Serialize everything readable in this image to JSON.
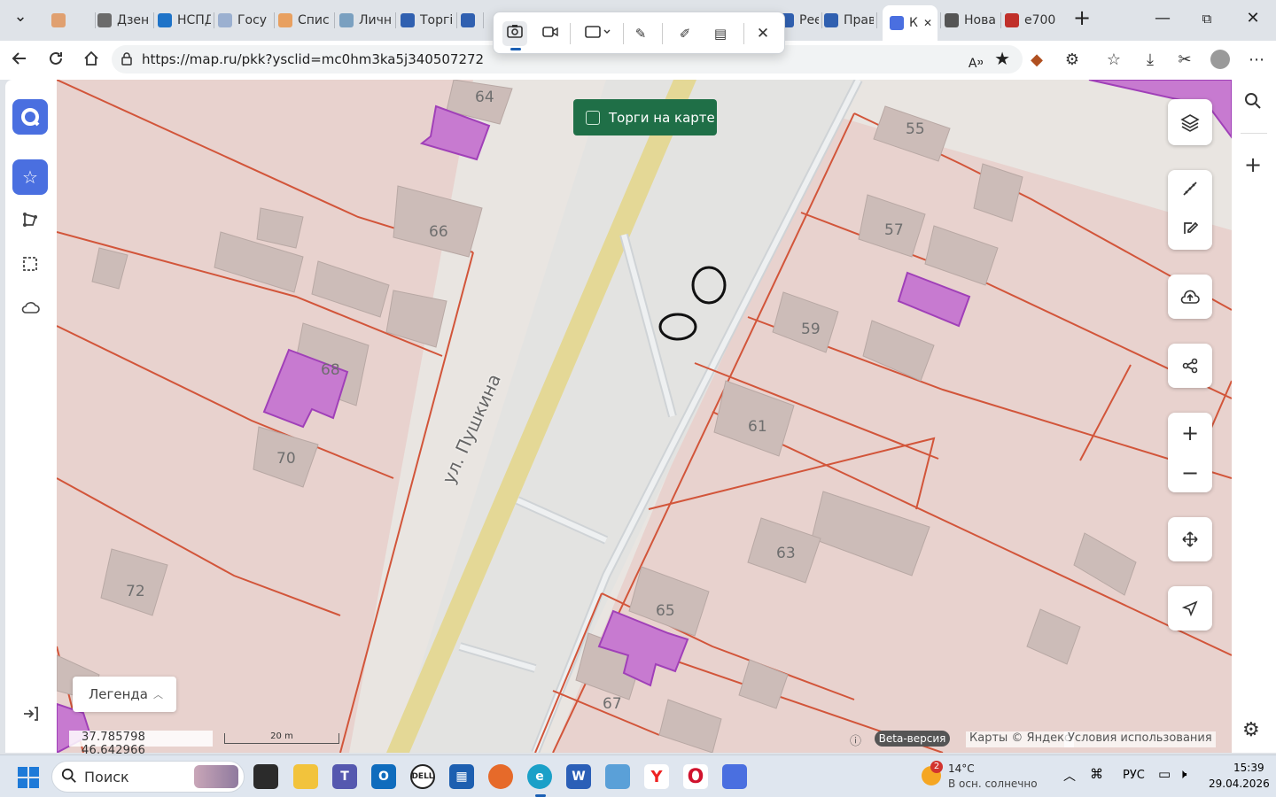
{
  "browser": {
    "tabs": [
      {
        "label": "",
        "icon": "mail-icon",
        "color": "#e0a070"
      },
      {
        "label": "Дзен",
        "icon": "dzen-icon",
        "color": "#6b6b6b"
      },
      {
        "label": "НСПД",
        "icon": "nspd-icon",
        "color": "#1e73c8"
      },
      {
        "label": "Госу",
        "icon": "gosuslugi-icon",
        "color": "#9bb0d0"
      },
      {
        "label": "Спис",
        "icon": "gmail-icon",
        "color": "#e8a060"
      },
      {
        "label": "Личн",
        "icon": "cabinet-icon",
        "color": "#7aa0c0"
      },
      {
        "label": "Торгі",
        "icon": "torgi-icon",
        "color": "#3060b0"
      },
      {
        "label": "",
        "icon": "torgi-icon-2",
        "color": "#3060b0"
      },
      {
        "label": "Реест",
        "icon": "rosreestr-icon",
        "color": "#3060b0"
      },
      {
        "label": "Прав",
        "icon": "rosreestr-icon-2",
        "color": "#3060b0"
      },
      {
        "label": "К",
        "icon": "map-icon",
        "color": "#4a6fe0",
        "active": true
      },
      {
        "label": "Нова",
        "icon": "new-tab-icon",
        "color": "#555555"
      },
      {
        "label": "е700",
        "icon": "pdf-icon",
        "color": "#c0302a"
      }
    ],
    "url": "https://map.ru/pkk?ysclid=mc0hm3ka5j340507272"
  },
  "snip_toolbar": {
    "tools": [
      "camera-icon",
      "video-icon",
      "rectangle-select-icon",
      "edit-image-icon",
      "pen-icon",
      "text-extract-icon",
      "close-icon"
    ]
  },
  "map": {
    "torgi_label": "Торги на карте",
    "street_label": "ул. Пушкина",
    "house_numbers": [
      "64",
      "66",
      "68",
      "70",
      "72",
      "55",
      "57",
      "59",
      "61",
      "63",
      "65",
      "67"
    ],
    "legend_label": "Легенда",
    "coords": "37.785798  46.642966",
    "scale_label": "20 m",
    "beta_label": "Beta-версия",
    "attribution": "Карты © Яндекс",
    "terms": "Условия использования",
    "colors": {
      "parcel_line": "#d2553a",
      "parcel_fill": "#e9d3cf",
      "highlight": "#c77ad0",
      "road": "#e7d98f",
      "building": "#cdbdba"
    }
  },
  "taskbar": {
    "search_placeholder": "Поиск",
    "weather_temp": "14°C",
    "weather_text": "В осн. солнечно",
    "weather_badge": "2",
    "lang": "РУС",
    "time": "15:39",
    "date": "29.04.2026"
  }
}
